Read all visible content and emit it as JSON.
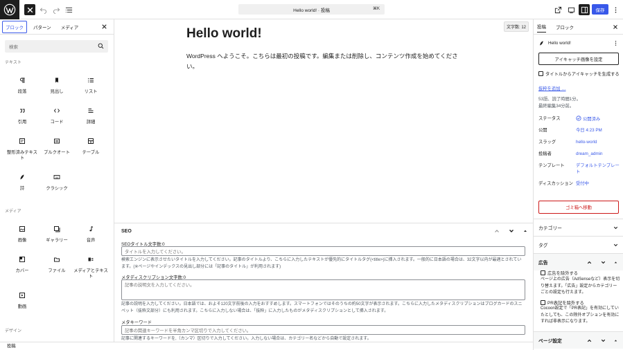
{
  "topbar": {
    "document_title": "Hello world! · 投稿",
    "shortcut": "⌘K",
    "save_label": "保存",
    "icons": [
      "wordpress-logo",
      "close-icon",
      "undo-icon",
      "redo-icon",
      "document-overview-icon",
      "view-external-icon",
      "preview-icon",
      "settings-sidebar-icon",
      "more-options-icon"
    ]
  },
  "inserter": {
    "tabs": [
      "ブロック",
      "パターン",
      "メディア"
    ],
    "search_placeholder": "検索",
    "categories": {
      "text": "テキスト",
      "media": "メディア",
      "design": "デザイン"
    },
    "text_blocks": [
      {
        "label": "段落",
        "icon": "paragraph-icon"
      },
      {
        "label": "見出し",
        "icon": "heading-icon"
      },
      {
        "label": "リスト",
        "icon": "list-icon"
      },
      {
        "label": "引用",
        "icon": "quote-icon"
      },
      {
        "label": "コード",
        "icon": "code-icon"
      },
      {
        "label": "詳細",
        "icon": "details-icon"
      },
      {
        "label": "整形済みテキスト",
        "icon": "preformatted-icon"
      },
      {
        "label": "プルクオート",
        "icon": "pullquote-icon"
      },
      {
        "label": "テーブル",
        "icon": "table-icon"
      },
      {
        "label": "詩",
        "icon": "verse-icon"
      },
      {
        "label": "クラシック",
        "icon": "classic-icon"
      }
    ],
    "media_blocks": [
      {
        "label": "画像",
        "icon": "image-icon"
      },
      {
        "label": "ギャラリー",
        "icon": "gallery-icon"
      },
      {
        "label": "音声",
        "icon": "audio-icon"
      },
      {
        "label": "カバー",
        "icon": "cover-icon"
      },
      {
        "label": "ファイル",
        "icon": "file-icon"
      },
      {
        "label": "メディアとテキスト",
        "icon": "media-text-icon"
      },
      {
        "label": "動画",
        "icon": "video-icon"
      }
    ]
  },
  "editor": {
    "word_count": "文字数: 12",
    "post_title": "Hello world!",
    "post_body": "WordPress へようこそ。こちらは最初の投稿です。編集または削除し、コンテンツ作成を始めてください。"
  },
  "seo": {
    "heading": "SEO",
    "title_label": "SEOタイトル文字数:0",
    "title_placeholder": "タイトルを入力してください。",
    "title_help": "検索エンジンに表示させたいタイトルを入力してください。記事のタイトルより、こちらに入力したテキストが優先的にタイトルタグ(<title>)に挿入されます。一般的に日本語の場合は、32文字以内が最適とされています。(※ページやインデックスの見出し部分には「記事のタイトル」が利用されます)",
    "desc_label": "メタディスクリプション文字数:0",
    "desc_placeholder": "記事の説明文を入力してください。",
    "desc_help": "記事の説明を入力してください。日本語では、およそ120文字前後の入力をおすすめします。スマートフォンではそのうちの約50文字が表示されます。こちらに入力したメタディスクリプションはブログカードのスニペット（抜粋文部分）にも利用されます。こちらに入力しない場合は、「抜粋」に入力したものがメタディスクリプションとして挿入されます。",
    "kw_label": "メタキーワード",
    "kw_placeholder": "記事の関連キーワードを半角カンマ区切りで入力してください。",
    "kw_help": "記事に関連するキーワードを,（カンマ）区切りで入力してください。入力しない場合は、カテゴリー名などから自動で設定されます。"
  },
  "footer": {
    "breadcrumb": "投稿"
  },
  "settings": {
    "tabs": [
      "投稿",
      "ブロック"
    ],
    "post_name": "Hello world!",
    "featured_image_button": "アイキャッチ画像を設定",
    "auto_featured_label": "タイトルからアイキャッチを生成する",
    "add_excerpt": "抜粋を追加 …",
    "stats_line1": "53語、読了時間1分。",
    "stats_line2": "最終編集34分前。",
    "rows": {
      "status_label": "ステータス",
      "status_value": "公開済み",
      "publish_label": "公開",
      "publish_value": "今日 4:23 PM",
      "slug_label": "スラッグ",
      "slug_value": "hello-world",
      "author_label": "投稿者",
      "author_value": "dream_admin",
      "template_label": "テンプレート",
      "template_value": "デフォルトテンプレート",
      "discussion_label": "ディスカッション",
      "discussion_value": "受付中"
    },
    "trash_button": "ゴミ箱へ移動",
    "category_heading": "カテゴリー",
    "tag_heading": "タグ",
    "ad_heading": "広告",
    "ad_exclude_label": "広告を除外する",
    "ad_exclude_help": "ページ上の広告（AdSenseなど）表示を切り替えます。「広告」設定からカテゴリーごとの設定も行えます。",
    "pr_label": "PR表記を除外する",
    "pr_help": "Cocoon設定で「PR表記」を有効にしていたとしても、この除外オプションを有効にすれば非表示になります。",
    "page_settings_heading": "ページ設定"
  }
}
